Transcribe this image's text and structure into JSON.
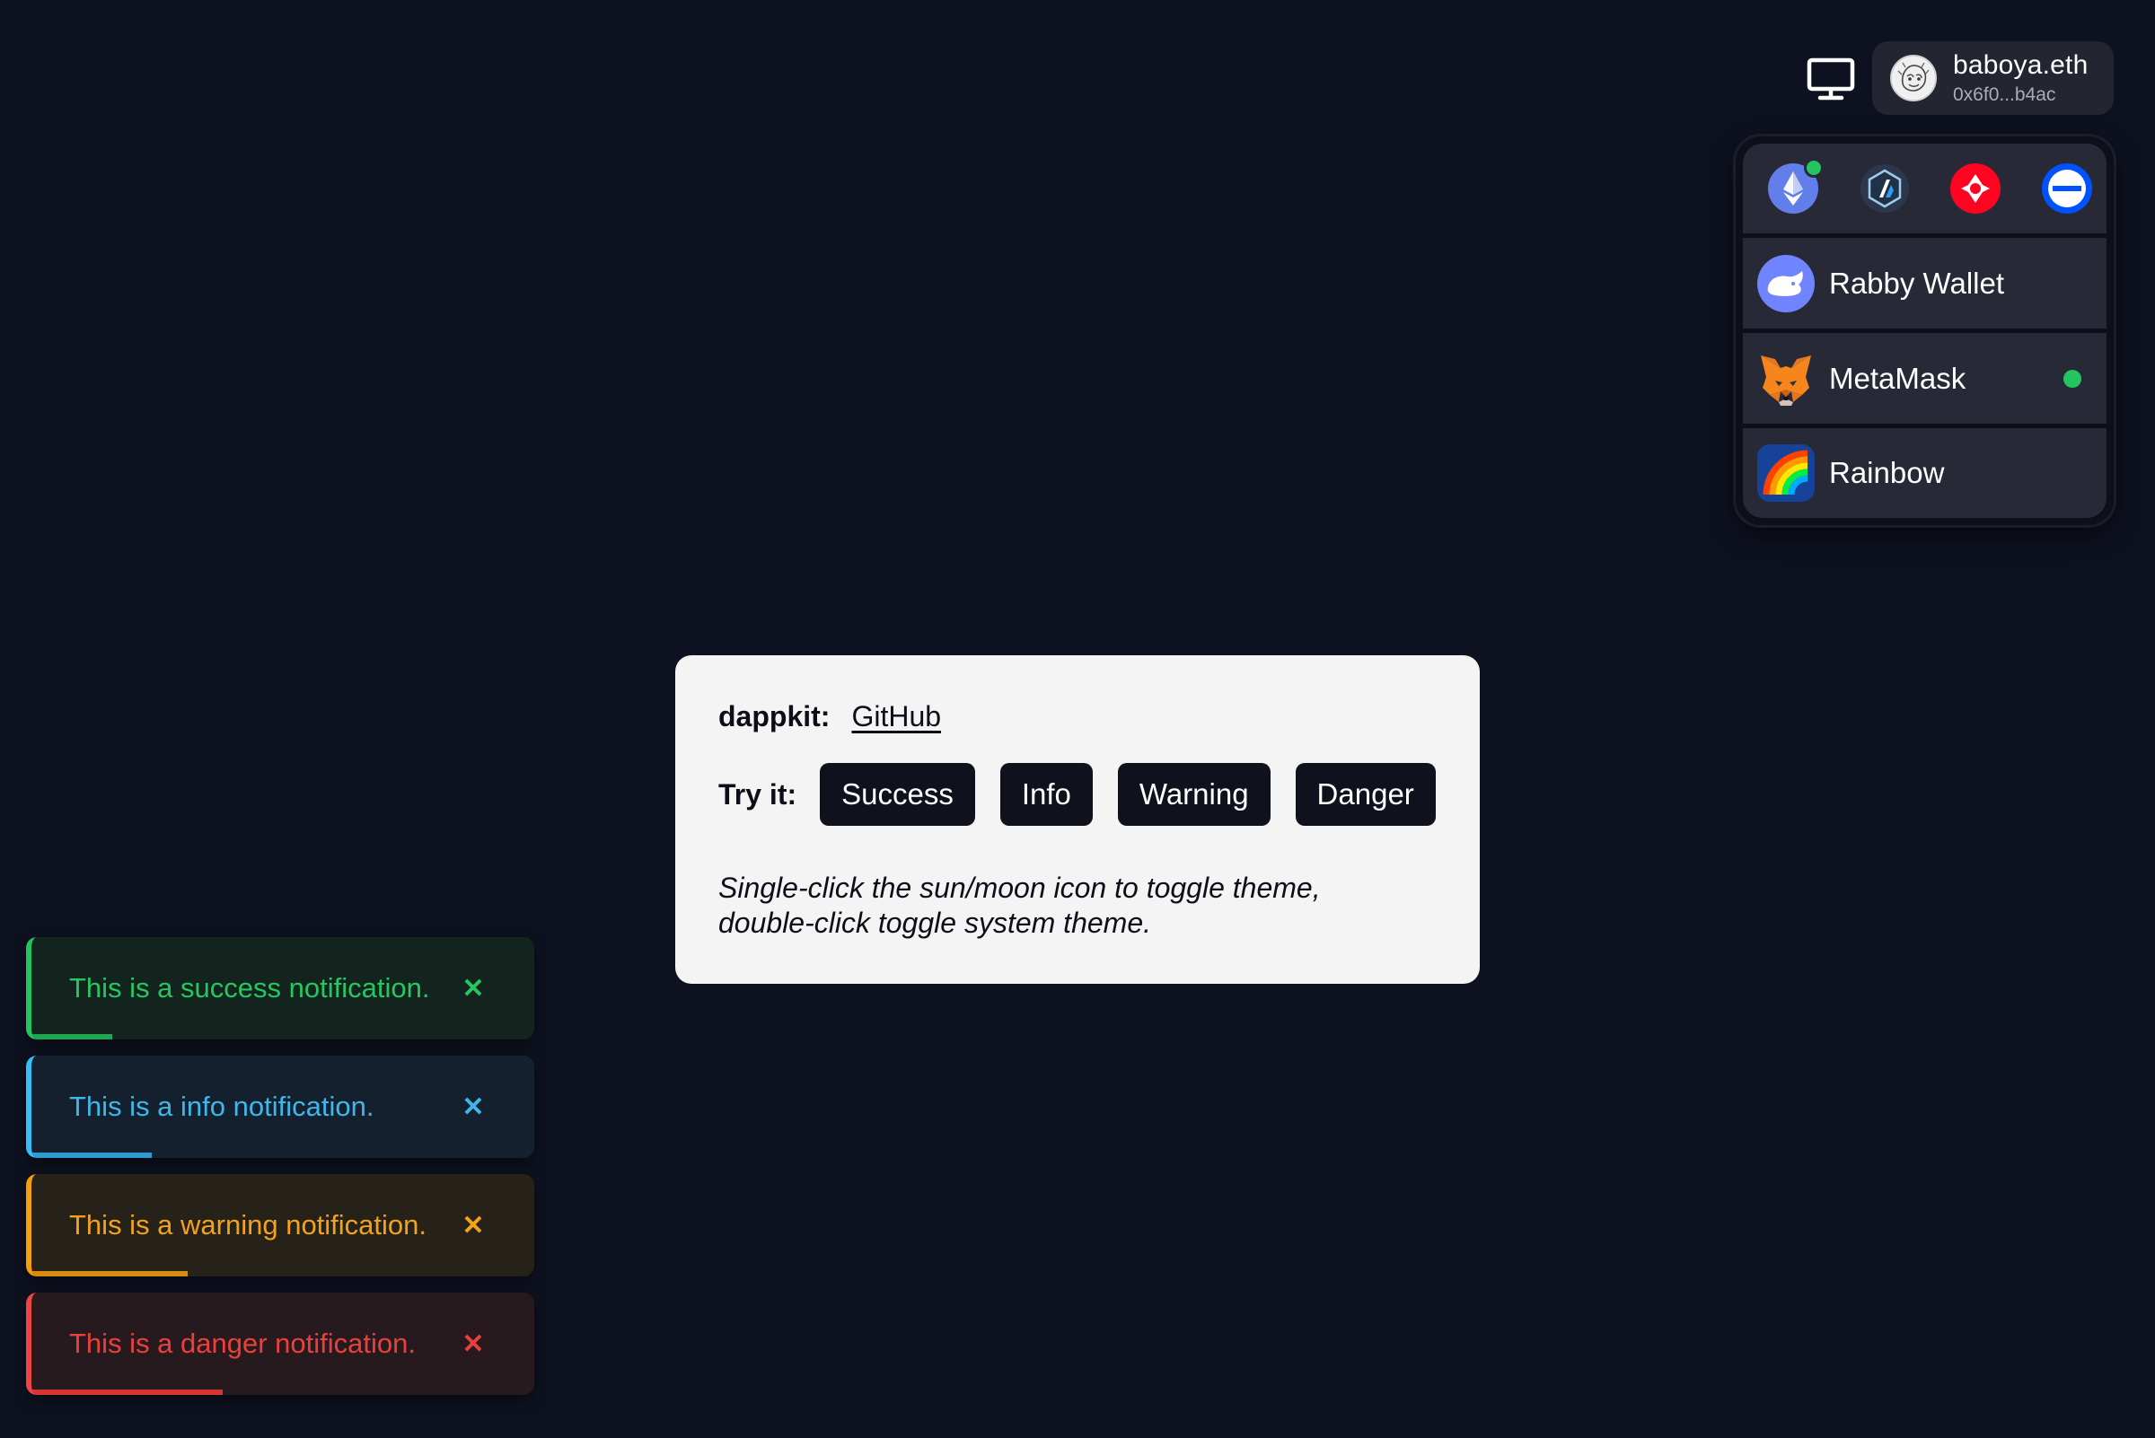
{
  "header": {
    "theme_toggle_icon": "monitor-icon",
    "account": {
      "ens_name": "baboya.eth",
      "address": "0x6f0...b4ac"
    }
  },
  "wallet_panel": {
    "chains": [
      {
        "icon": "ethereum-icon",
        "active": true
      },
      {
        "icon": "arbitrum-icon",
        "active": false
      },
      {
        "icon": "optimism-icon",
        "active": false
      },
      {
        "icon": "base-icon",
        "active": false
      }
    ],
    "wallets": [
      {
        "label": "Rabby Wallet",
        "icon": "rabby-icon",
        "connected": false
      },
      {
        "label": "MetaMask",
        "icon": "metamask-icon",
        "connected": true
      },
      {
        "label": "Rainbow",
        "icon": "rainbow-icon",
        "connected": false
      }
    ]
  },
  "card": {
    "title_label": "dappkit:",
    "link_text": "GitHub",
    "try_label": "Try it:",
    "buttons": {
      "success": "Success",
      "info": "Info",
      "warning": "Warning",
      "danger": "Danger"
    },
    "hint": "Single-click the sun/moon icon to toggle theme, double-click toggle system theme."
  },
  "notifications": [
    {
      "type": "success",
      "message": "This is a success notification.",
      "close": "✕",
      "color": "#22c55e",
      "progress": 0.16
    },
    {
      "type": "info",
      "message": "This is a info notification.",
      "close": "✕",
      "color": "#38bdf8",
      "progress": 0.24
    },
    {
      "type": "warning",
      "message": "This is a warning notification.",
      "close": "✕",
      "color": "#f59e0b",
      "progress": 0.31
    },
    {
      "type": "danger",
      "message": "This is a danger notification.",
      "close": "✕",
      "color": "#ef4444",
      "progress": 0.38
    }
  ]
}
